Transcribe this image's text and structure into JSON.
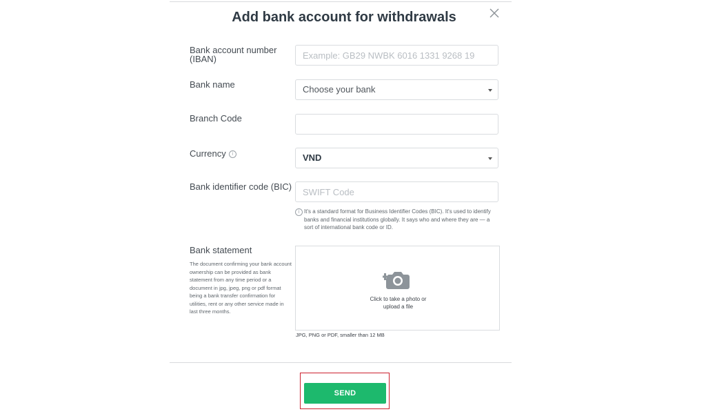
{
  "dialog": {
    "title": "Add bank account for withdrawals"
  },
  "fields": {
    "iban_label_line1": "Bank account number",
    "iban_label_line2": "(IBAN)",
    "iban_placeholder": "Example: GB29 NWBK 6016 1331 9268 19",
    "bank_name_label": "Bank name",
    "bank_name_value": "Choose your bank",
    "branch_code_label": "Branch Code",
    "branch_code_value": "",
    "currency_label": "Currency",
    "currency_value": "VND",
    "bic_label": "Bank identifier code (BIC)",
    "bic_placeholder": "SWIFT Code",
    "bic_hint": "It's a standard format for Business Identifier Codes (BIC). It's used to identify banks and financial institutions globally. It says who and where they are — a sort of international bank code or ID."
  },
  "statement": {
    "label": "Bank statement",
    "description": "The document confirming your bank account ownership can be provided as bank statement from any time period or a document in jpg, jpeg, png or pdf format being a bank transfer confirmation for utilities, rent or any other service made in last three months.",
    "upload_line1": "Click to take a photo or",
    "upload_line2": "upload a file",
    "formats": "JPG, PNG or PDF, smaller than 12 MB"
  },
  "actions": {
    "send_label": "SEND"
  },
  "icons": {
    "close": "close-icon",
    "info": "info-icon",
    "caret": "chevron-down-icon",
    "camera": "camera-add-icon"
  },
  "colors": {
    "accent": "#1db96d",
    "highlight": "#cc1f2d"
  }
}
